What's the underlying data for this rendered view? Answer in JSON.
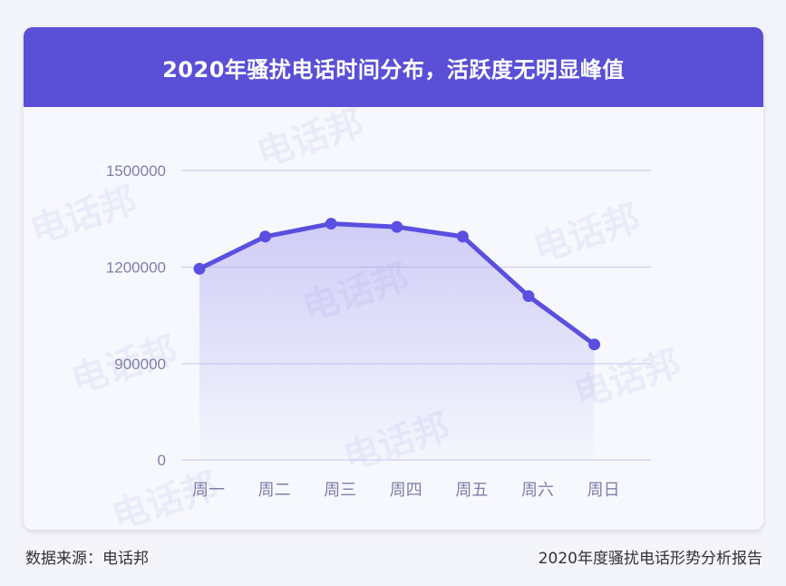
{
  "title": "2020年骚扰电话时间分布，活跃度无明显峰值",
  "watermark_text": "电话邦",
  "footer": {
    "source": "数据来源：电话邦",
    "report": "2020年度骚扰电话形势分析报告"
  },
  "colors": {
    "header": "#5a4fd6",
    "line": "#5a4fe0",
    "grid": "#cfd0f0",
    "tick_text": "#7b80a8"
  },
  "chart_data": {
    "type": "line",
    "title": "2020年骚扰电话时间分布，活跃度无明显峰值",
    "xlabel": "",
    "ylabel": "",
    "categories": [
      "周一",
      "周二",
      "周三",
      "周四",
      "周五",
      "周六",
      "周日"
    ],
    "values": [
      1195000,
      1295000,
      1335000,
      1325000,
      1295000,
      1110000,
      960000
    ],
    "y_ticks": [
      0,
      900000,
      1200000,
      1500000
    ],
    "y_tick_labels": [
      "0",
      "900000",
      "1200000",
      "1500000"
    ],
    "grid": true,
    "legend": "none"
  }
}
